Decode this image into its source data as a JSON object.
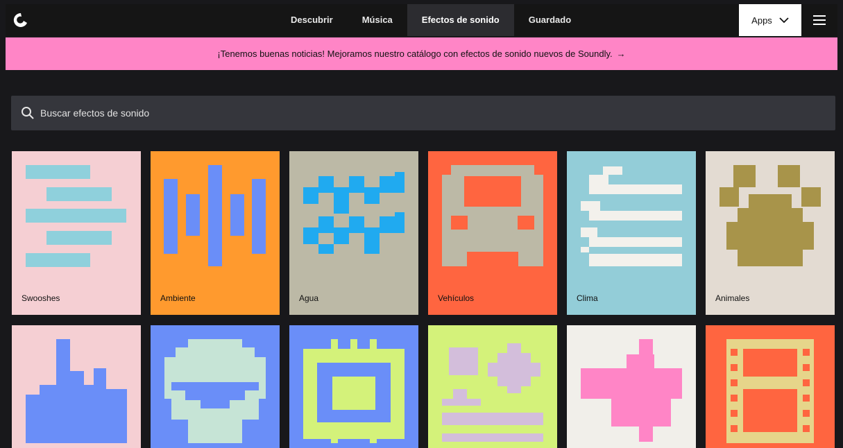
{
  "nav": {
    "items": [
      {
        "label": "Descubrir",
        "active": false
      },
      {
        "label": "Música",
        "active": false
      },
      {
        "label": "Efectos de sonido",
        "active": true
      },
      {
        "label": "Guardado",
        "active": false
      }
    ],
    "apps_label": "Apps"
  },
  "banner": {
    "text": "¡Tenemos buenas noticias! Mejoramos nuestro catálogo con efectos de sonido nuevos de Soundly.",
    "arrow": "→"
  },
  "search": {
    "placeholder": "Buscar efectos de sonido"
  },
  "categories": [
    {
      "label": "Swooshes",
      "bg": "#f5cfd3",
      "accent": "#8fd0dc"
    },
    {
      "label": "Ambiente",
      "bg": "#ff9a2e",
      "accent": "#6a8ef8"
    },
    {
      "label": "Agua",
      "bg": "#bcb9a6",
      "accent": "#20aaf0"
    },
    {
      "label": "Vehículos",
      "bg": "#ff6540",
      "accent": "#bcb9a6"
    },
    {
      "label": "Clima",
      "bg": "#93cdd8",
      "accent": "#f3f1ec"
    },
    {
      "label": "Animales",
      "bg": "#e3dbd2",
      "accent": "#a8944a"
    },
    {
      "label": "",
      "bg": "#f5cfd3",
      "accent": "#6a8ef8"
    },
    {
      "label": "",
      "bg": "#6a8ef8",
      "accent": "#c6e4d6"
    },
    {
      "label": "",
      "bg": "#6a8ef8",
      "accent": "#d4f27a"
    },
    {
      "label": "",
      "bg": "#d4f27a",
      "accent": "#d3bedb"
    },
    {
      "label": "",
      "bg": "#f1efea",
      "accent": "#ff85c6"
    },
    {
      "label": "",
      "bg": "#ff6540",
      "accent": "#e6d58a"
    }
  ]
}
